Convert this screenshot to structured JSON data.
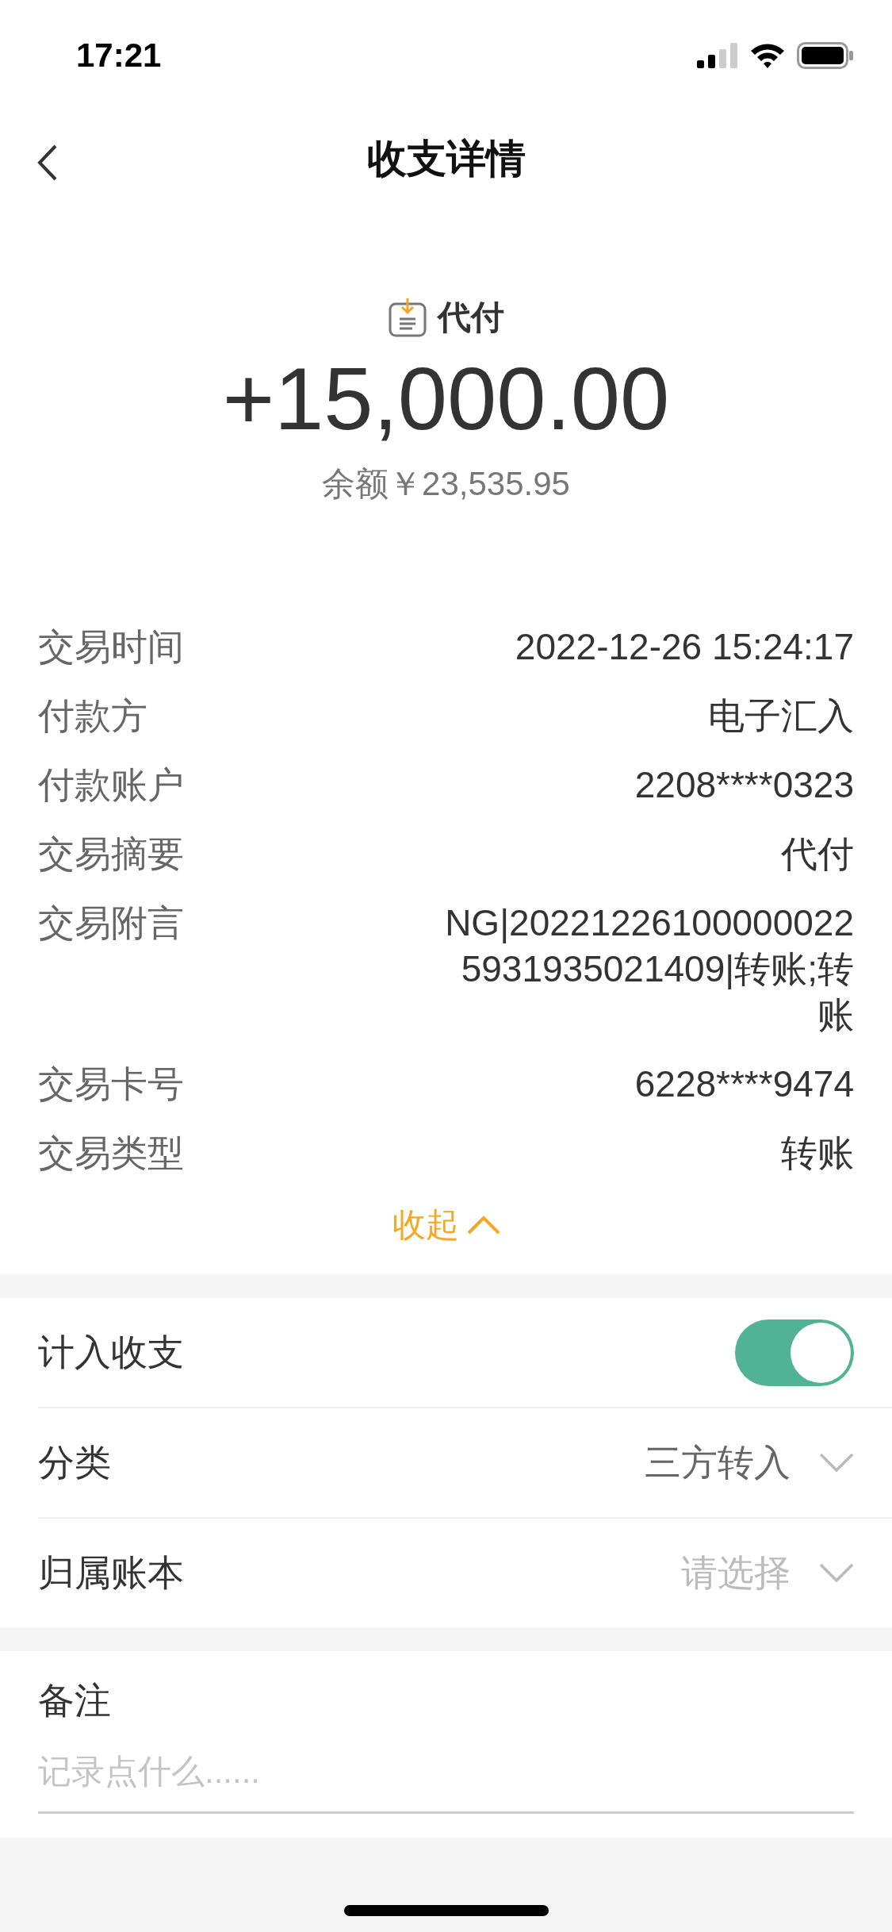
{
  "status_bar": {
    "time": "17:21"
  },
  "nav": {
    "title": "收支详情"
  },
  "summary": {
    "type_label": "代付",
    "amount": "+15,000.00",
    "balance": "余额￥23,535.95"
  },
  "details": [
    {
      "label": "交易时间",
      "value": "2022-12-26 15:24:17"
    },
    {
      "label": "付款方",
      "value": "电子汇入"
    },
    {
      "label": "付款账户",
      "value": "2208****0323"
    },
    {
      "label": "交易摘要",
      "value": "代付"
    },
    {
      "label": "交易附言",
      "value": "NG|202212261000000225931935021409|转账;转账"
    },
    {
      "label": "交易卡号",
      "value": "6228****9474"
    },
    {
      "label": "交易类型",
      "value": "转账"
    }
  ],
  "collapse": {
    "label": "收起",
    "expanded": true
  },
  "settings": [
    {
      "kind": "toggle",
      "label": "计入收支",
      "on": true
    },
    {
      "kind": "select",
      "label": "分类",
      "value": "三方转入"
    },
    {
      "kind": "select",
      "label": "归属账本",
      "placeholder": "请选择"
    }
  ],
  "note": {
    "label": "备注",
    "placeholder": "记录点什么......"
  }
}
